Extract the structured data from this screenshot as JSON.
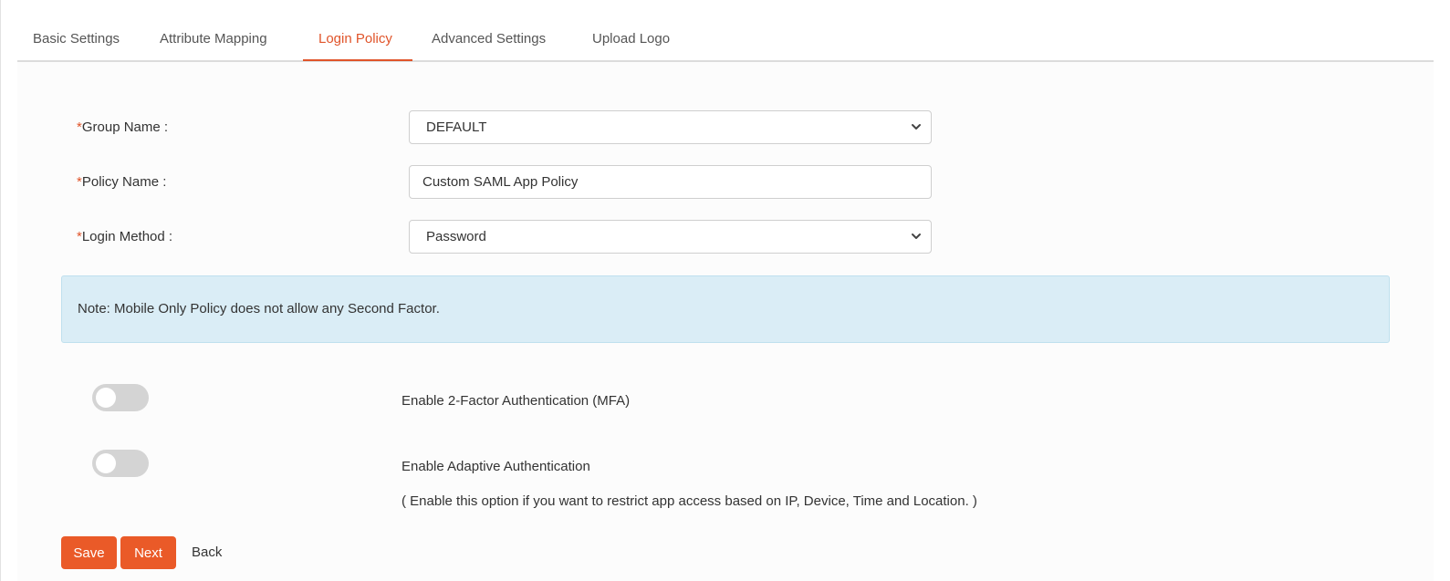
{
  "tabs": [
    {
      "label": "Basic Settings",
      "active": false
    },
    {
      "label": "Attribute Mapping",
      "active": false
    },
    {
      "label": "Login Policy",
      "active": true
    },
    {
      "label": "Advanced Settings",
      "active": false
    },
    {
      "label": "Upload Logo",
      "active": false
    }
  ],
  "form": {
    "required_marker": "*",
    "group_name": {
      "label": "Group Name :",
      "value": "DEFAULT",
      "icon": "chevron-down-icon"
    },
    "policy_name": {
      "label": "Policy Name :",
      "value": "Custom SAML App Policy"
    },
    "login_method": {
      "label": "Login Method :",
      "value": "Password",
      "icon": "chevron-down-icon"
    }
  },
  "note": "Note: Mobile Only Policy does not allow any Second Factor.",
  "options": {
    "mfa": {
      "label": "Enable 2-Factor Authentication (MFA)",
      "enabled": false
    },
    "adaptive": {
      "label": "Enable Adaptive Authentication",
      "description": "( Enable this option if you want to restrict app access based on IP, Device, Time and Location. )",
      "enabled": false
    }
  },
  "actions": {
    "save": "Save",
    "next": "Next",
    "back": "Back"
  },
  "colors": {
    "accent": "#e0542a",
    "button": "#ea5a28",
    "note_bg": "#daedf6",
    "toggle_off": "#d4d4d4"
  }
}
